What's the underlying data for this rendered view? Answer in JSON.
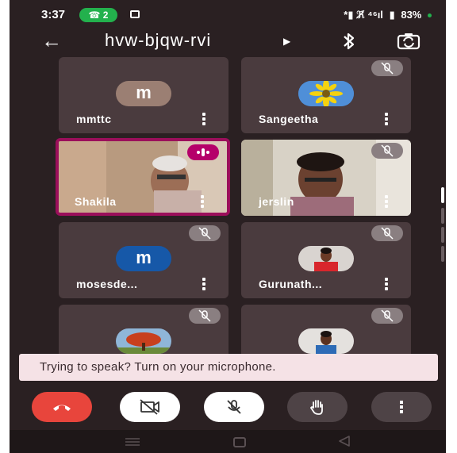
{
  "status_bar": {
    "time": "3:37",
    "call_badge": "2",
    "signal_text": "*▮ ℜ̸ ⁴⁶ıl",
    "battery": "83%"
  },
  "app_bar": {
    "meeting_code": "hvw-bjqw-rvi"
  },
  "participants": [
    {
      "name": "mmttc",
      "avatar_letter": "m",
      "avatar_color": "#9b7f73",
      "muted": false
    },
    {
      "name": "Sangeetha",
      "avatar": "sunflower-photo",
      "muted": true
    },
    {
      "name": "Shakila",
      "video": true,
      "speaking": true,
      "muted": false
    },
    {
      "name": "jerslin",
      "video": true,
      "muted": true
    },
    {
      "name": "mosesde...",
      "avatar_letter": "m",
      "avatar_color": "#1658a8",
      "muted": true
    },
    {
      "name": "Gurunath...",
      "avatar": "person-photo",
      "muted": true
    },
    {
      "name": "",
      "avatar": "tree-photo",
      "muted": true
    },
    {
      "name": "",
      "avatar": "person-photo",
      "muted": true
    }
  ],
  "toast": {
    "message": "Trying to speak? Turn on your microphone."
  },
  "colors": {
    "background": "#2a2022",
    "tile": "#4a3b3e",
    "end_call": "#e8453c",
    "speaking_border": "#9b0f5b",
    "toast_bg": "#f5e2e6"
  }
}
